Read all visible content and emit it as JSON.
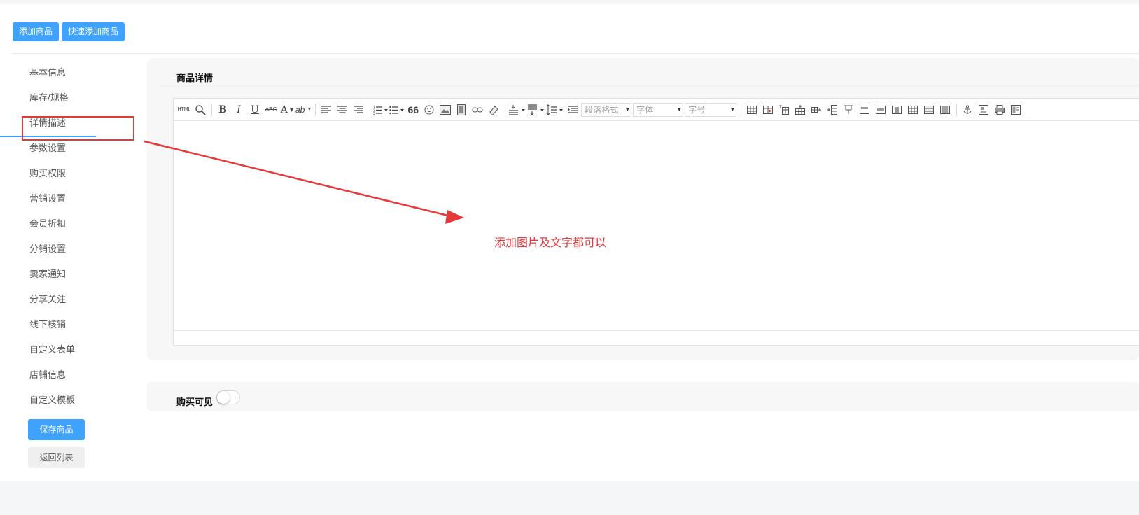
{
  "header": {
    "buttons": [
      "添加商品",
      "快速添加商品"
    ]
  },
  "sidebar": {
    "items": [
      {
        "label": "基本信息"
      },
      {
        "label": "库存/规格"
      },
      {
        "label": "详情描述",
        "active": true
      },
      {
        "label": "参数设置"
      },
      {
        "label": "购买权限"
      },
      {
        "label": "营销设置"
      },
      {
        "label": "会员折扣"
      },
      {
        "label": "分销设置"
      },
      {
        "label": "卖家通知"
      },
      {
        "label": "分享关注"
      },
      {
        "label": "线下核销"
      },
      {
        "label": "自定义表单"
      },
      {
        "label": "店铺信息"
      },
      {
        "label": "自定义模板"
      }
    ],
    "save_label": "保存商品",
    "back_label": "返回列表"
  },
  "detail": {
    "title": "商品详情",
    "toolbar": {
      "html_label": "HTML",
      "bold": "B",
      "italic": "I",
      "underline": "U",
      "strike": "ABC",
      "fontcolor": "A",
      "highlight": "ab",
      "quote": "66",
      "paragraph_placeholder": "段落格式",
      "font_placeholder": "字体",
      "size_placeholder": "字号"
    },
    "annotation": "添加图片及文字都可以",
    "annotation_color": "#e4393c"
  },
  "visibility": {
    "label": "购买可见",
    "enabled": false
  },
  "colors": {
    "primary": "#3fa2ff",
    "highlight_box": "#e4393c"
  }
}
